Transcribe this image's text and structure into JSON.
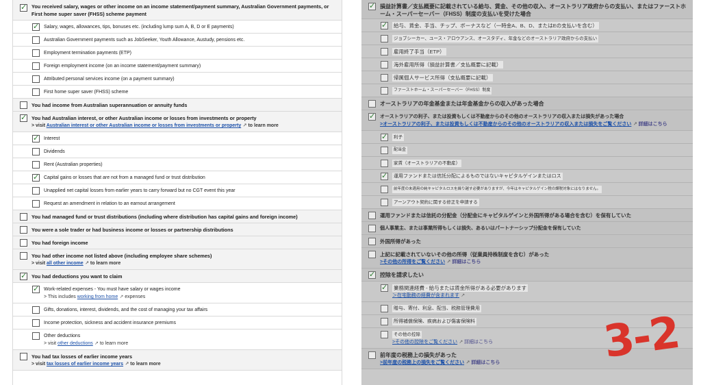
{
  "left": {
    "rows": [
      {
        "level": 0,
        "checked": true,
        "h": 30,
        "label": "You received salary, wages or other income on an income statement/payment summary, Australian Government payments, or First home super saver (FHSS) scheme payment"
      },
      {
        "level": 1,
        "checked": true,
        "h": 19,
        "label": "Salary, wages, allowances, tips, bonuses etc. (including lump sum A, B, D or E payments)"
      },
      {
        "level": 1,
        "checked": false,
        "h": 19,
        "label": "Australian Government payments such as JobSeeker, Youth Allowance, Austudy, pensions etc."
      },
      {
        "level": 1,
        "checked": false,
        "h": 19,
        "label": "Employment termination payments (ETP)"
      },
      {
        "level": 1,
        "checked": false,
        "h": 19,
        "label": "Foreign employment income (on an income statement/payment summary)"
      },
      {
        "level": 1,
        "checked": false,
        "h": 19,
        "label": "Attributed personal services income (on a payment summary)"
      },
      {
        "level": 1,
        "checked": false,
        "h": 19,
        "label": "First home super saver (FHSS) scheme"
      },
      {
        "level": 0,
        "checked": false,
        "h": 19,
        "label": "You had income from Australian superannuation or annuity funds"
      },
      {
        "level": 0,
        "checked": true,
        "h": 30,
        "label": "You had Australian interest, or other Australian income or losses from investments or property",
        "sub": {
          "pre": "> visit ",
          "link": "Australian interest or other Australian income or losses from investments or property",
          "post": " to learn more"
        }
      },
      {
        "level": 1,
        "checked": true,
        "h": 19,
        "label": "Interest"
      },
      {
        "level": 1,
        "checked": false,
        "h": 19,
        "label": "Dividends"
      },
      {
        "level": 1,
        "checked": false,
        "h": 19,
        "label": "Rent (Australian properties)"
      },
      {
        "level": 1,
        "checked": true,
        "h": 19,
        "label": "Capital gains or losses that are not from a managed fund or trust distribution"
      },
      {
        "level": 1,
        "checked": false,
        "h": 19,
        "label": "Unapplied net capital losses from earlier years to carry forward but no CGT event this year"
      },
      {
        "level": 1,
        "checked": false,
        "h": 19,
        "label": "Request an amendment in relation to an earnout arrangement"
      },
      {
        "level": 0,
        "checked": false,
        "h": 19,
        "label": "You had managed fund or trust distributions (including where distribution has capital gains and foreign income)"
      },
      {
        "level": 0,
        "checked": false,
        "h": 19,
        "label": "You were a sole trader or had business income or losses or partnership distributions"
      },
      {
        "level": 0,
        "checked": false,
        "h": 19,
        "label": "You had foreign income"
      },
      {
        "level": 0,
        "checked": false,
        "h": 30,
        "label": "You had other income not listed above (including employee share schemes)",
        "sub": {
          "pre": "> visit ",
          "link": "all other income",
          "post": " to learn more"
        }
      },
      {
        "level": 0,
        "checked": true,
        "h": 19,
        "label": "You had deductions you want to claim"
      },
      {
        "level": 1,
        "checked": true,
        "h": 30,
        "label": "Work-related expenses - You must have salary or wages income",
        "sub": {
          "pre": "> This includes ",
          "link": "working from home",
          "post": " expenses"
        }
      },
      {
        "level": 1,
        "checked": false,
        "h": 19,
        "label": "Gifts, donations, interest, dividends, and the cost of managing your tax affairs"
      },
      {
        "level": 1,
        "checked": false,
        "h": 19,
        "label": "Income protection, sickness and accident insurance premiums"
      },
      {
        "level": 1,
        "checked": false,
        "h": 30,
        "label": "Other deductions",
        "sub": {
          "pre": "> visit ",
          "link": "other deductions",
          "post": " to learn more"
        }
      },
      {
        "level": 0,
        "checked": false,
        "h": 30,
        "label": "You had tax losses of earlier income years",
        "sub": {
          "pre": "> visit ",
          "link": "tax losses of earlier income years",
          "post": " to learn more"
        }
      }
    ]
  },
  "right": {
    "rows": [
      {
        "level": 0,
        "checked": true,
        "h": 28,
        "fs": 8,
        "label": "損益計算書／支払概要に記載されている給与、賃金、その他の収入、オーストラリア政府からの支払い、またはファーストホーム・スーパーセーバー（FHSS）制度の支払いを受けた場合"
      },
      {
        "level": 1,
        "checked": true,
        "h": 19,
        "fs": 7.5,
        "hl": true,
        "label": "給与、賃金、手当、チップ、ボーナスなど（一時金A、B、D、またはEの支払いを含む）"
      },
      {
        "level": 1,
        "checked": false,
        "h": 19,
        "fs": 6.5,
        "hl": true,
        "label": "ジョブシーカー、ユース・アロウアンス、オースタディ、年金などのオーストラリア政府からの支払い"
      },
      {
        "level": 1,
        "checked": false,
        "h": 19,
        "fs": 7.5,
        "hl": true,
        "label": "雇用終了手当（ETP）"
      },
      {
        "level": 1,
        "checked": false,
        "h": 19,
        "fs": 7.5,
        "hl": true,
        "label": "海外雇用所得（損益計算書／支払概要に記載）"
      },
      {
        "level": 1,
        "checked": false,
        "h": 19,
        "fs": 7.5,
        "hl": true,
        "label": "帰属個人サービス所得（支払概要に記載）"
      },
      {
        "level": 1,
        "checked": false,
        "h": 19,
        "fs": 6,
        "hl": true,
        "label": "ファーストホーム・スーパーセーバー（FHSS）制度"
      },
      {
        "level": 0,
        "checked": false,
        "h": 19,
        "fs": 8,
        "label": "オーストラリアの年金基金または年金基金からの収入があった場合"
      },
      {
        "level": 0,
        "checked": true,
        "h": 30,
        "fs": 7,
        "label": "オーストラリアの利子、または投資もしくは不動産からのその他のオーストラリアの収入または損失があった場合",
        "sub": {
          "pre": "",
          "link": ">オーストラリアの利子、または投資もしくは不動産からのその他のオーストラリアの収入または損失をご覧ください",
          "post": " 詳細はこちら"
        }
      },
      {
        "level": 1,
        "checked": true,
        "h": 19,
        "fs": 6.5,
        "hl": true,
        "label": "利子"
      },
      {
        "level": 1,
        "checked": false,
        "h": 19,
        "fs": 6,
        "hl": true,
        "label": "配当金"
      },
      {
        "level": 1,
        "checked": false,
        "h": 19,
        "fs": 6.5,
        "hl": true,
        "label": "家賃（オーストラリアの不動産）"
      },
      {
        "level": 1,
        "checked": true,
        "h": 19,
        "fs": 7,
        "hl": true,
        "label": "運用ファンドまたは信託分配によるものではないキャピタルゲインまたはロス"
      },
      {
        "level": 1,
        "checked": false,
        "h": 19,
        "fs": 5.5,
        "hl": true,
        "label": "前年度の未適用の純キャピタルロスを繰り越す必要がありますが、今年はキャピタルゲイン税の課税対象にはなりません。"
      },
      {
        "level": 1,
        "checked": false,
        "h": 19,
        "fs": 6.5,
        "hl": true,
        "label": "アーンアウト契約に関する修正を申請する"
      },
      {
        "level": 0,
        "checked": false,
        "h": 19,
        "fs": 7.5,
        "label": "運用ファンドまたは信託の分配金（分配金にキャピタルゲインと外国所得がある場合を含む）を保有していた"
      },
      {
        "level": 0,
        "checked": false,
        "h": 19,
        "fs": 7,
        "label": "個人事業主、または事業所得もしくは損失、あるいはパートナーシップ分配金を保有していた"
      },
      {
        "level": 0,
        "checked": false,
        "h": 19,
        "fs": 7.5,
        "label": "外国所得があった"
      },
      {
        "level": 0,
        "checked": false,
        "h": 30,
        "fs": 7.5,
        "label": "上記に記載されていないその他の所得（従業員持株制度を含む）があった",
        "sub": {
          "pre": "",
          "link": ">その他の所得をご覧ください",
          "post": " 詳細はこちら"
        }
      },
      {
        "level": 0,
        "checked": true,
        "h": 19,
        "fs": 8,
        "label": "控除を請求したい"
      },
      {
        "level": 1,
        "checked": true,
        "h": 30,
        "fs": 7.5,
        "hl": true,
        "label": "業務関連経費 - 給与または賃金所得がある必要があります",
        "sub": {
          "pre": "",
          "link": "＞在宅勤務の経費が含まれます",
          "post": ""
        }
      },
      {
        "level": 1,
        "checked": false,
        "h": 19,
        "fs": 7,
        "hl": true,
        "label": "贈与、寄付、利息、配当、税務管理費用"
      },
      {
        "level": 1,
        "checked": false,
        "h": 19,
        "fs": 7,
        "hl": true,
        "label": "所得補償保険、疾病および傷害保険料"
      },
      {
        "level": 1,
        "checked": false,
        "h": 30,
        "fs": 6.5,
        "hl": true,
        "label": "その他の控除",
        "sub": {
          "pre": "",
          "link": ">その他の控除をご覧ください",
          "post": " 詳細はこちら"
        }
      },
      {
        "level": 0,
        "checked": false,
        "h": 30,
        "fs": 8,
        "label": "前年度の税務上の損失があった",
        "sub": {
          "pre": "",
          "link": ">前年度の税務上の損失をご覧ください",
          "post": " 詳細はこちら"
        }
      }
    ]
  },
  "stamp": "3-2",
  "colors": {
    "check": "#2e7d32",
    "link": "#1a4fa8",
    "stamp": "#d9342b"
  }
}
